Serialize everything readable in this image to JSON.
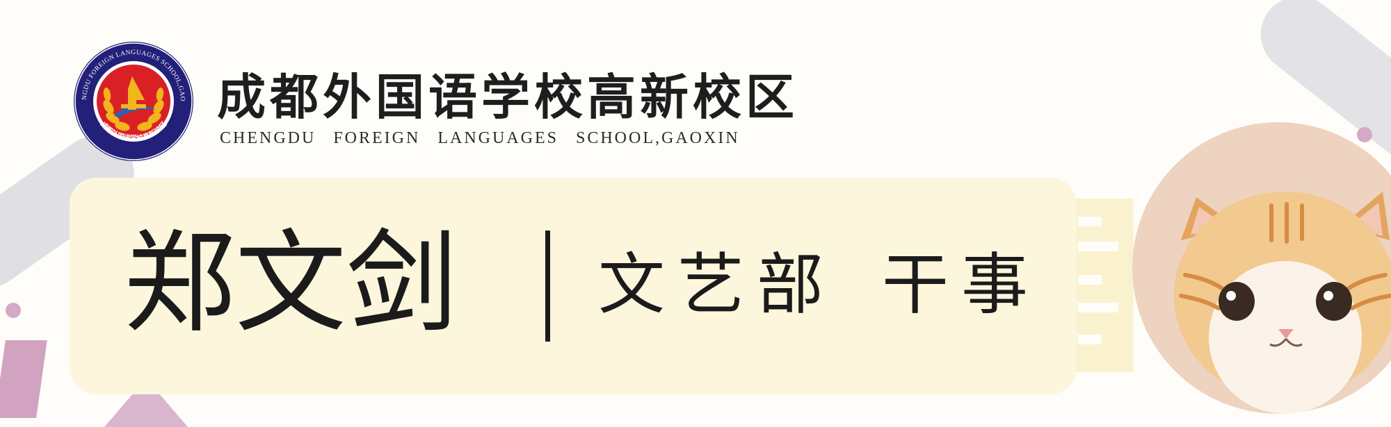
{
  "school": {
    "name_cn": "成都外国语学校高新校区",
    "name_en": "CHENGDU  FOREIGN  LANGUAGES  SCHOOL,GAOXIN",
    "logo_ring_text": "CHENGDU FOREIGN LANGUAGES SCHOOL,GAOXIN",
    "logo_bottom_text": "成都外国语学校高新校区"
  },
  "person": {
    "name": "郑文剑",
    "department": "文艺部",
    "title": "干事"
  },
  "colors": {
    "background": "#fffdf9",
    "panel": "#fcf6dd",
    "logo_blue": "#23207a",
    "logo_red": "#d92027",
    "logo_gold": "#f2b51b",
    "accent_pink": "#d7a8c6",
    "accent_gray": "#e0dfe3",
    "cat_circle": "#edd3c0"
  },
  "icons": {
    "logo": "school-emblem-icon",
    "portrait": "cat-portrait-icon"
  }
}
